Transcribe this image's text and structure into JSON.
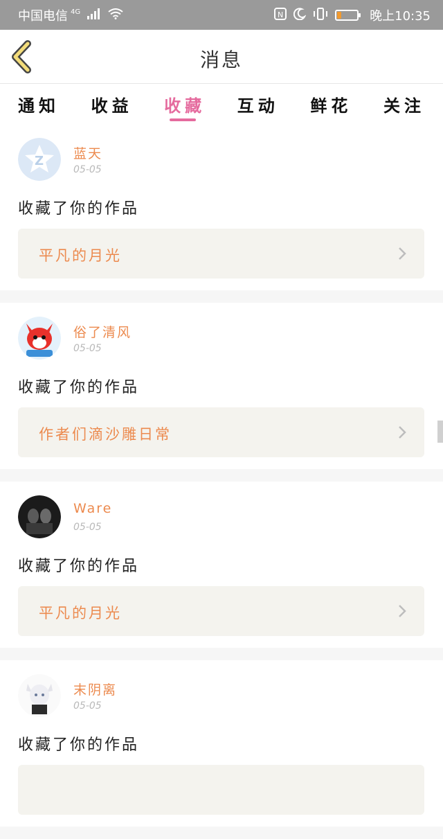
{
  "status_bar": {
    "carrier": "中国电信",
    "network": "4G",
    "time": "晚上10:35",
    "battery_level": 0.2,
    "icons": [
      "signal-icon",
      "wifi-icon",
      "nfc-icon",
      "moon-icon",
      "vibrate-icon",
      "battery-icon"
    ]
  },
  "header": {
    "title": "消息",
    "back_icon": "back-chevron-icon"
  },
  "tabs": [
    {
      "label": "通知",
      "active": false
    },
    {
      "label": "收益",
      "active": false
    },
    {
      "label": "收藏",
      "active": true
    },
    {
      "label": "互动",
      "active": false
    },
    {
      "label": "鲜花",
      "active": false
    },
    {
      "label": "关注",
      "active": false
    }
  ],
  "colors": {
    "accent": "#e56b9e",
    "name_orange": "#ec8a4e",
    "box_bg": "#f4f3ee"
  },
  "messages": [
    {
      "user": "蓝天",
      "date": "05-05",
      "action": "收藏了你的作品",
      "work": "平凡的月光",
      "avatar": "default-star-avatar"
    },
    {
      "user": "俗了清风",
      "date": "05-05",
      "action": "收藏了你的作品",
      "work": "作者们滴沙雕日常",
      "avatar": "fox-cartoon-avatar"
    },
    {
      "user": "Ware",
      "date": "05-05",
      "action": "收藏了你的作品",
      "work": "平凡的月光",
      "avatar": "dark-photo-avatar"
    },
    {
      "user": "末阴离",
      "date": "05-05",
      "action": "收藏了你的作品",
      "work": "",
      "avatar": "anime-girl-avatar"
    }
  ]
}
